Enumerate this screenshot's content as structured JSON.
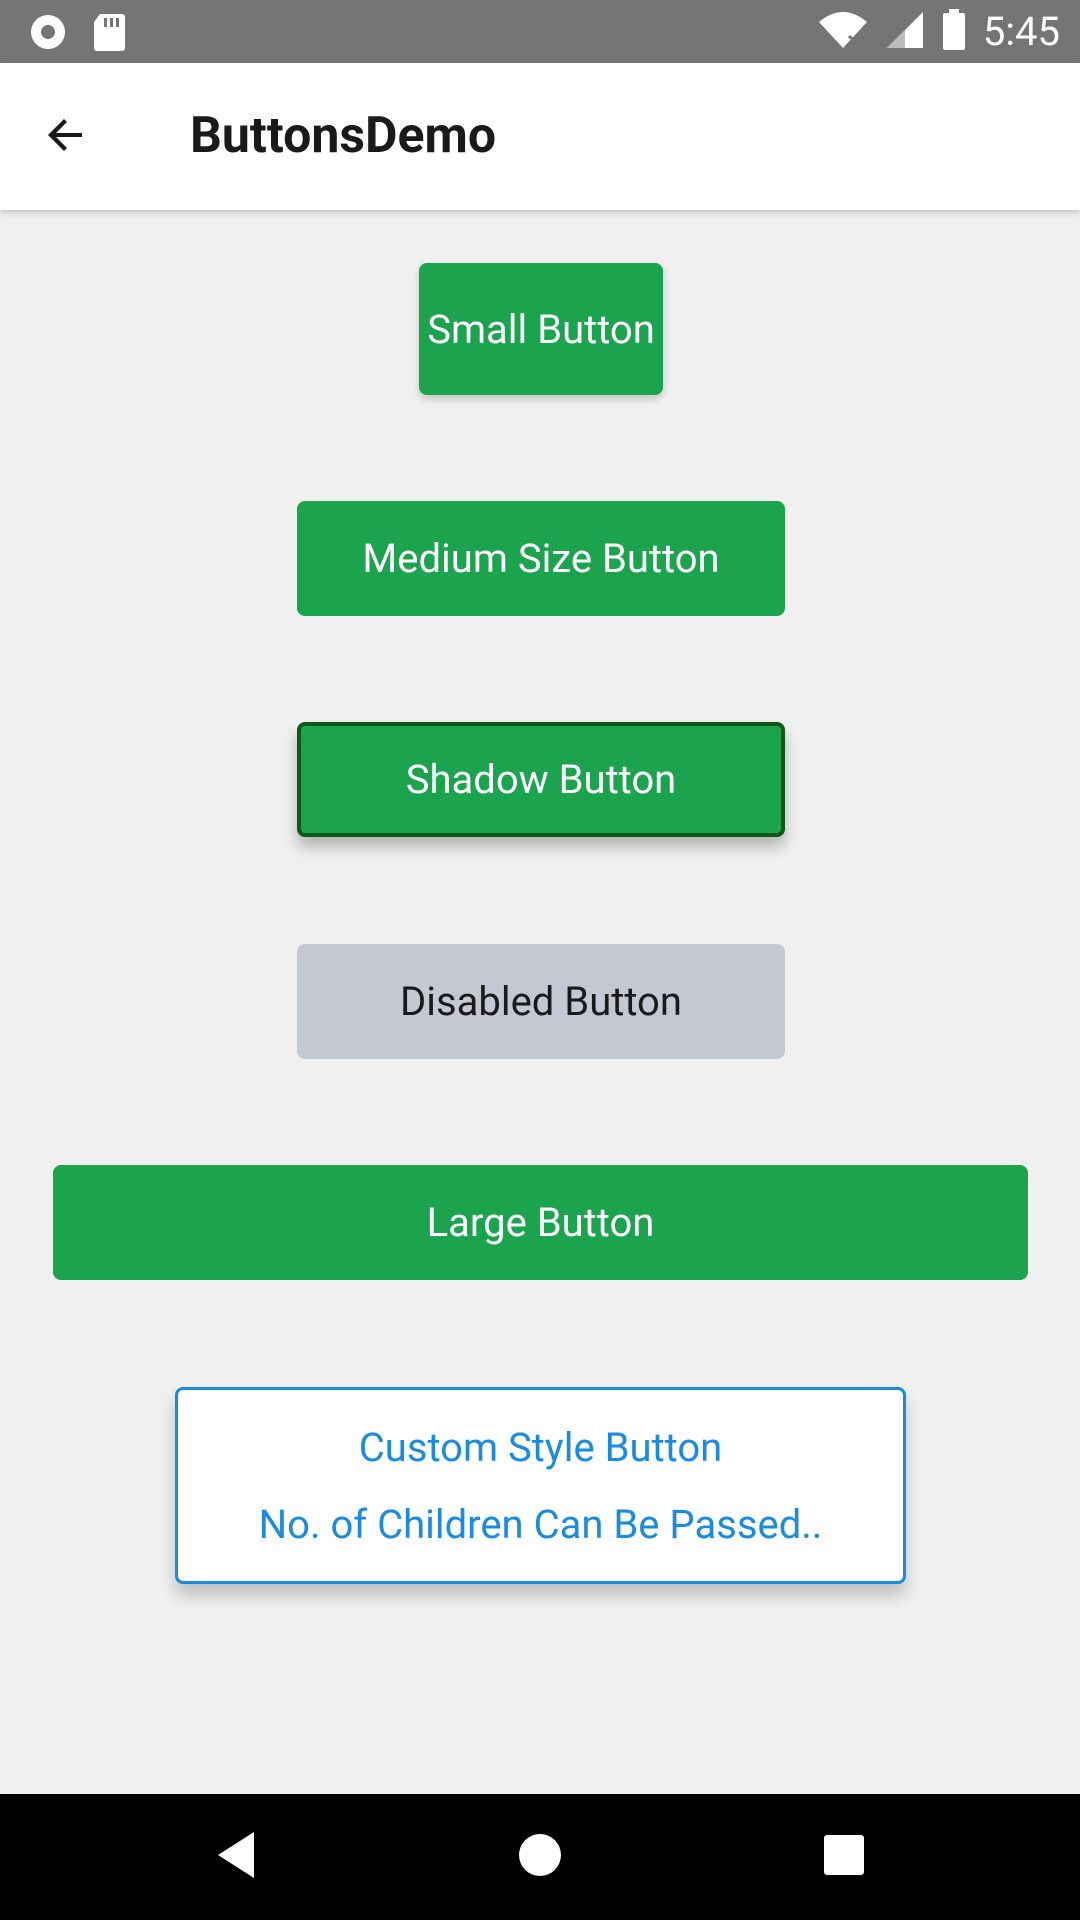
{
  "status_bar": {
    "time": "5:45",
    "icons": [
      "record-icon",
      "sd-card-icon",
      "wifi-icon",
      "cell-signal-icon",
      "battery-icon"
    ]
  },
  "app_bar": {
    "title": "ButtonsDemo",
    "back_icon": "arrow-back-icon"
  },
  "buttons": {
    "small": "Small Button",
    "medium": "Medium Size Button",
    "shadow": "Shadow Button",
    "disabled": "Disabled Button",
    "large": "Large Button",
    "custom_line1": "Custom Style Button",
    "custom_line2": "No. of Children Can Be Passed.."
  },
  "nav_bar": {
    "icons": [
      "back-triangle-icon",
      "home-circle-icon",
      "recents-square-icon"
    ]
  },
  "colors": {
    "primary_green": "#1ba34e",
    "shadow_border": "#0d5a18",
    "disabled_bg": "#c4c8d2",
    "custom_blue": "#1a8be0",
    "background": "#f0f0f0"
  }
}
